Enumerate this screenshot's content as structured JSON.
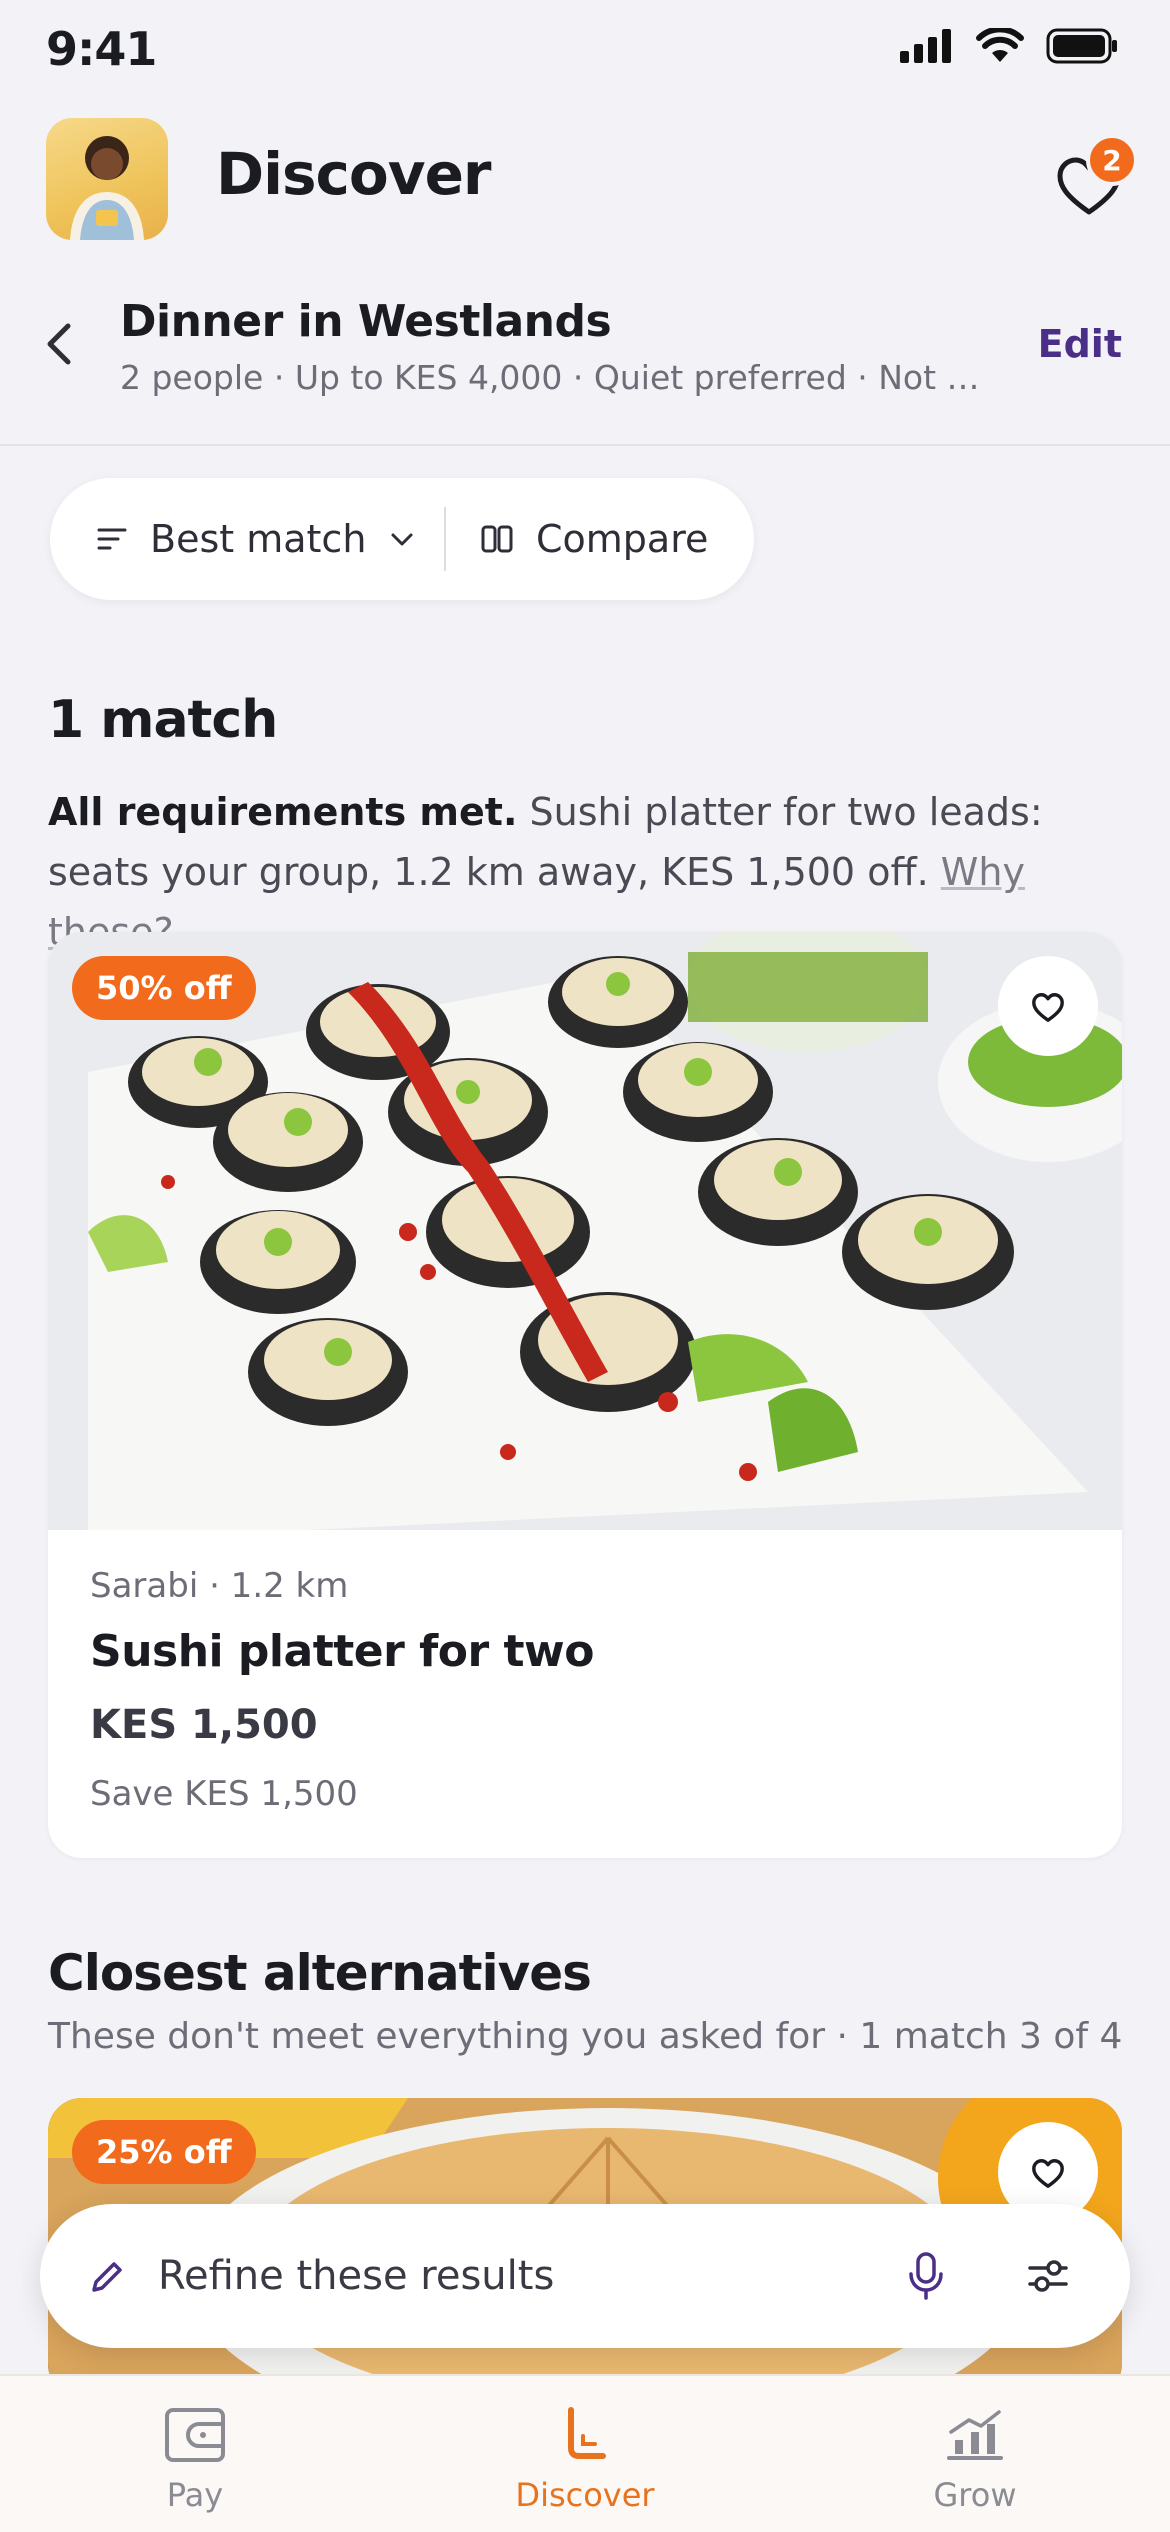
{
  "status_bar": {
    "time": "9:41"
  },
  "header": {
    "title": "Discover",
    "favorites_count": "2"
  },
  "context": {
    "title": "Dinner in Westlands",
    "subtitle": "2 people · Up to KES 4,000 · Quiet preferred · Not J...",
    "edit_label": "Edit"
  },
  "toolbar": {
    "sort_label": "Best match",
    "compare_label": "Compare"
  },
  "results": {
    "count_label": "1 match",
    "summary_bold": "All requirements met.",
    "summary_text": " Sushi platter for two leads: seats your group, 1.2 km away, KES 1,500 off. ",
    "why_link": "Why these?"
  },
  "card": {
    "badge": "50% off",
    "meta": "Sarabi · 1.2 km",
    "title": "Sushi platter for two",
    "price": "KES 1,500",
    "savings": "Save KES 1,500"
  },
  "alternatives": {
    "title": "Closest alternatives",
    "subtitle": "These don't meet everything you asked for · 1 match 3 of 4",
    "first_badge": "25% off"
  },
  "refine": {
    "placeholder": "Refine these results"
  },
  "tabs": [
    {
      "label": "Pay",
      "icon": "wallet-icon"
    },
    {
      "label": "Discover",
      "icon": "discover-icon"
    },
    {
      "label": "Grow",
      "icon": "growth-chart-icon"
    }
  ],
  "colors": {
    "accent_orange": "#f26a1b",
    "brand_purple": "#4b2f87",
    "tab_active": "#e8731f"
  }
}
